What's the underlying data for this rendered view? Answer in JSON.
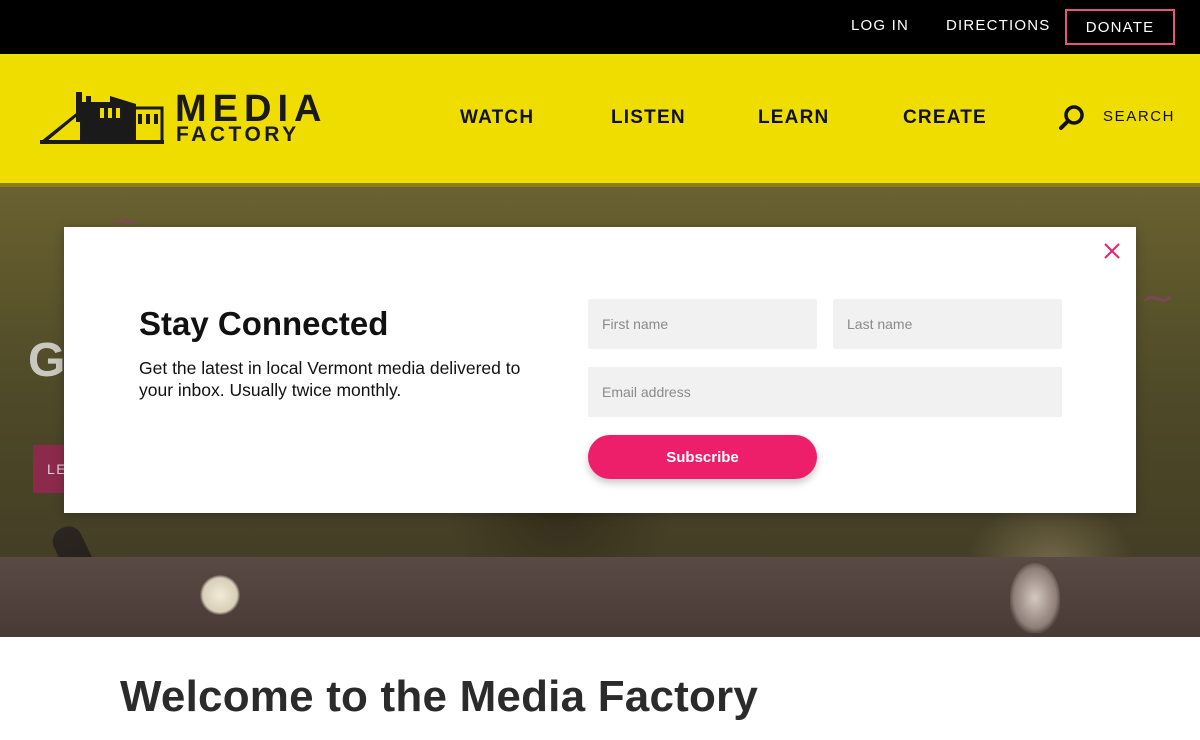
{
  "topbar": {
    "login": "LOG IN",
    "directions": "DIRECTIONS",
    "donate": "DONATE"
  },
  "header": {
    "logo_word1": "MEDIA",
    "logo_word2": "FACTORY",
    "nav": {
      "watch": "WATCH",
      "listen": "LISTEN",
      "learn": "LEARN",
      "create": "CREATE"
    },
    "search_label": "SEARCH",
    "search_icon": "search-icon"
  },
  "hero": {
    "title": "G",
    "button": "LE"
  },
  "modal": {
    "title": "Stay Connected",
    "description": "Get the latest in local Vermont media delivered to your inbox. Usually twice monthly.",
    "first_name_placeholder": "First name",
    "last_name_placeholder": "Last name",
    "email_placeholder": "Email address",
    "subscribe": "Subscribe",
    "close_icon": "close-icon"
  },
  "welcome": {
    "heading": "Welcome to the Media Factory"
  },
  "colors": {
    "brand_yellow": "#f0dd00",
    "accent_pink": "#ee1f6a",
    "donate_border": "#e8547e",
    "topbar_black": "#000000"
  }
}
